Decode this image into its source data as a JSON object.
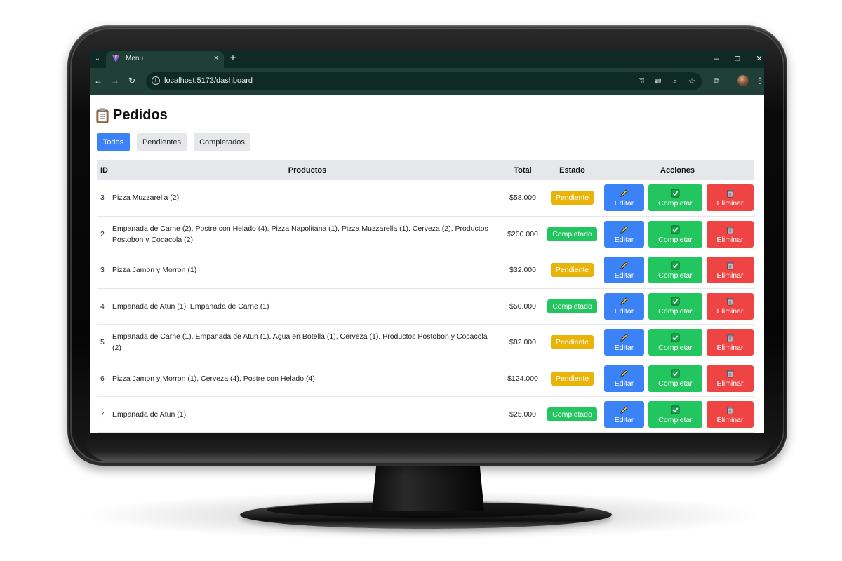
{
  "browser": {
    "tab_title": "Menu",
    "tab_close": "×",
    "new_tab": "+",
    "url": "localhost:5173/dashboard",
    "window_controls": {
      "minimize": "–",
      "maximize": "❐",
      "close": "✕"
    }
  },
  "page": {
    "title": "Pedidos",
    "filters": [
      "Todos",
      "Pendientes",
      "Completados"
    ],
    "active_filter": "Todos",
    "table": {
      "headers": {
        "id": "ID",
        "productos": "Productos",
        "total": "Total",
        "estado": "Estado",
        "acciones": "Acciones"
      },
      "action_labels": {
        "edit": "Editar",
        "complete": "Completar",
        "delete": "Eliminar"
      },
      "rows": [
        {
          "id": "3",
          "productos": "Pizza Muzzarella (2)",
          "total": "$58.000",
          "estado": "Pendiente"
        },
        {
          "id": "2",
          "productos": "Empanada de Carne (2), Postre con Helado (4), Pizza Napolitana (1), Pizza Muzzarella (1), Cerveza (2), Productos Postobon y Cocacola (2)",
          "total": "$200.000",
          "estado": "Completado"
        },
        {
          "id": "3",
          "productos": "Pizza Jamon y Morron (1)",
          "total": "$32.000",
          "estado": "Pendiente"
        },
        {
          "id": "4",
          "productos": "Empanada de Atun (1), Empanada de Carne (1)",
          "total": "$50.000",
          "estado": "Completado"
        },
        {
          "id": "5",
          "productos": "Empanada de Carne (1), Empanada de Atun (1), Agua en Botella (1), Cerveza (1), Productos Postobon y Cocacola (2)",
          "total": "$82.000",
          "estado": "Pendiente"
        },
        {
          "id": "6",
          "productos": "Pizza Jamon y Morron (1), Cerveza (4), Postre con Helado (4)",
          "total": "$124.000",
          "estado": "Pendiente"
        },
        {
          "id": "7",
          "productos": "Empanada de Atun (1)",
          "total": "$25.000",
          "estado": "Completado"
        }
      ]
    }
  },
  "colors": {
    "primary": "#3b82f6",
    "success": "#22c55e",
    "warning": "#eab308",
    "danger": "#ef4444",
    "browser_frame": "#1f3f37"
  }
}
